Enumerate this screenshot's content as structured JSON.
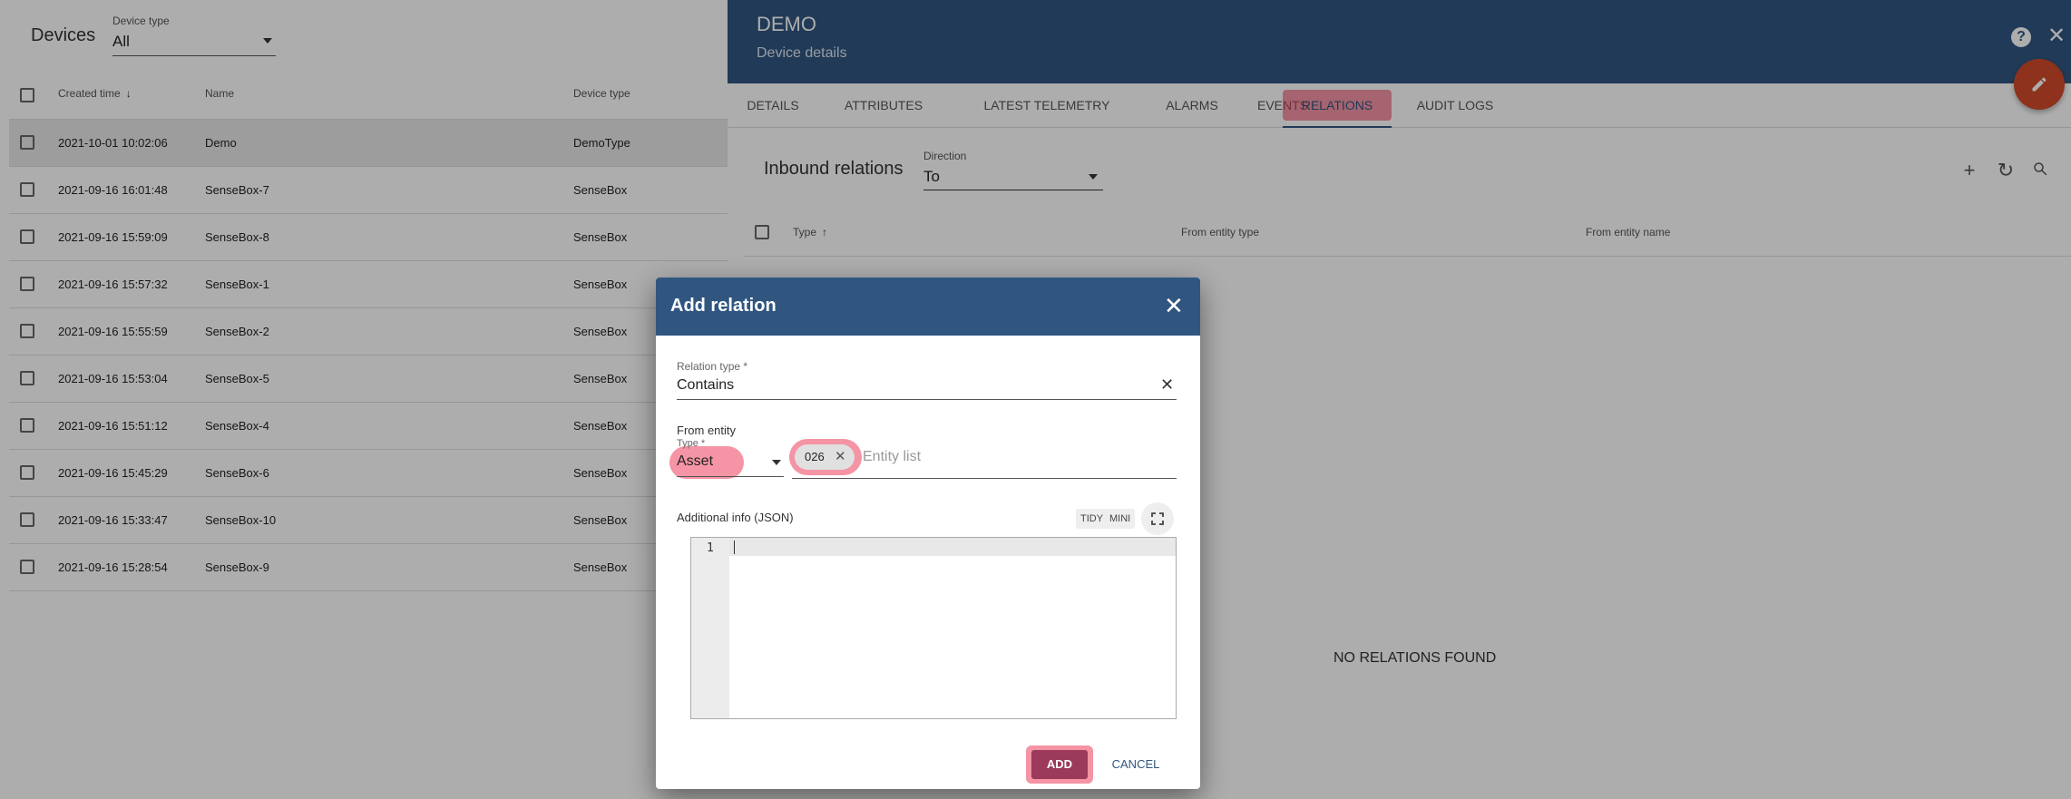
{
  "devices": {
    "title": "Devices",
    "device_type_label": "Device type",
    "device_type_value": "All",
    "columns": {
      "created": "Created time",
      "name": "Name",
      "type": "Device type"
    },
    "rows": [
      {
        "time": "2021-10-01 10:02:06",
        "name": "Demo",
        "type": "DemoType"
      },
      {
        "time": "2021-09-16 16:01:48",
        "name": "SenseBox-7",
        "type": "SenseBox"
      },
      {
        "time": "2021-09-16 15:59:09",
        "name": "SenseBox-8",
        "type": "SenseBox"
      },
      {
        "time": "2021-09-16 15:57:32",
        "name": "SenseBox-1",
        "type": "SenseBox"
      },
      {
        "time": "2021-09-16 15:55:59",
        "name": "SenseBox-2",
        "type": "SenseBox"
      },
      {
        "time": "2021-09-16 15:53:04",
        "name": "SenseBox-5",
        "type": "SenseBox"
      },
      {
        "time": "2021-09-16 15:51:12",
        "name": "SenseBox-4",
        "type": "SenseBox"
      },
      {
        "time": "2021-09-16 15:45:29",
        "name": "SenseBox-6",
        "type": "SenseBox"
      },
      {
        "time": "2021-09-16 15:33:47",
        "name": "SenseBox-10",
        "type": "SenseBox"
      },
      {
        "time": "2021-09-16 15:28:54",
        "name": "SenseBox-9",
        "type": "SenseBox"
      }
    ]
  },
  "details": {
    "name": "DEMO",
    "subtitle": "Device details",
    "tabs": [
      "DETAILS",
      "ATTRIBUTES",
      "LATEST TELEMETRY",
      "ALARMS",
      "EVENTS",
      "RELATIONS",
      "AUDIT LOGS"
    ],
    "active_tab": "RELATIONS",
    "relations_title": "Inbound relations",
    "direction_label": "Direction",
    "direction_value": "To",
    "columns": {
      "type": "Type",
      "from_type": "From entity type",
      "from_name": "From entity name"
    },
    "empty_text": "NO RELATIONS FOUND"
  },
  "dialog": {
    "title": "Add relation",
    "relation_type_label": "Relation type *",
    "relation_type_value": "Contains",
    "from_entity_label": "From entity",
    "type_label": "Type *",
    "type_value": "Asset",
    "chip": "026",
    "entity_list_placeholder": "Entity list",
    "additional_info_label": "Additional info (JSON)",
    "tidy": "TIDY",
    "mini": "MINI",
    "line_number": "1",
    "add": "ADD",
    "cancel": "CANCEL"
  },
  "colors": {
    "primary": "#305680",
    "fab": "#d24a2b",
    "add_button": "#9b3a5a",
    "highlight": "#eb3c5a"
  },
  "icons": [
    "arrow-down-icon",
    "help-icon",
    "close-icon",
    "edit-pencil-icon",
    "add-icon",
    "refresh-icon",
    "search-icon",
    "dropdown-arrow-icon",
    "fullscreen-icon"
  ]
}
